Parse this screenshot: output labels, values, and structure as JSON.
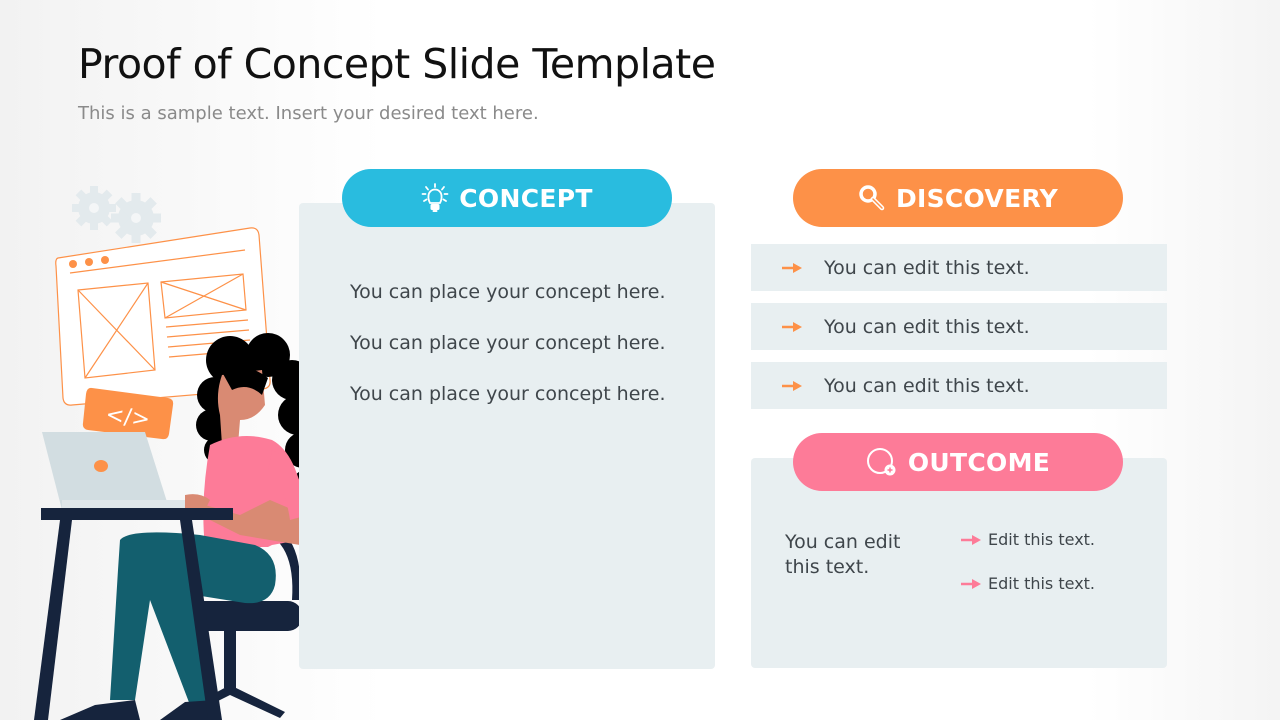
{
  "slide": {
    "title": "Proof of Concept Slide Template",
    "subtitle": "This is a sample text. Insert your desired text here."
  },
  "concept": {
    "label": "CONCEPT",
    "icon": "lightbulb-icon",
    "color": "#29bcdf",
    "lines": [
      "You can place your concept here.",
      "You can place your concept here.",
      "You can place your concept here."
    ]
  },
  "discovery": {
    "label": "DISCOVERY",
    "icon": "magnifier-icon",
    "color": "#fd9148",
    "items": [
      "You can edit this text.",
      "You can edit this text.",
      "You can edit this text."
    ]
  },
  "outcome": {
    "label": "OUTCOME",
    "icon": "circle-plus-icon",
    "color": "#fd7b98",
    "main_text": "You can edit this text.",
    "bullets": [
      "Edit this text.",
      "Edit this text."
    ]
  },
  "illustration": {
    "code_badge": "</>"
  },
  "colors": {
    "card_bg": "#e8eff1",
    "text": "#3f464b",
    "navy": "#16243d",
    "teal": "#135f6e",
    "pink": "#fd7b98",
    "orange": "#fd9148"
  }
}
